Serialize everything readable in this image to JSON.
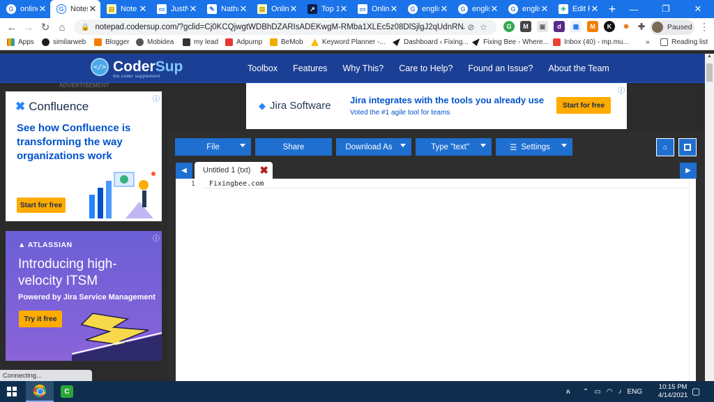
{
  "browser": {
    "tabs": [
      {
        "label": "online",
        "favicon": "google-icon"
      },
      {
        "label": "Notes",
        "favicon": "google-icon",
        "active": true
      },
      {
        "label": "Note",
        "favicon": "notepad-icon"
      },
      {
        "label": "JustN",
        "favicon": "doc-icon"
      },
      {
        "label": "Natha",
        "favicon": "doc-icon"
      },
      {
        "label": "Onlin",
        "favicon": "notepad-icon"
      },
      {
        "label": "Top 1",
        "favicon": "tv-icon"
      },
      {
        "label": "Onlin",
        "favicon": "doc-icon"
      },
      {
        "label": "englis",
        "favicon": "google-icon"
      },
      {
        "label": "englis",
        "favicon": "google-icon"
      },
      {
        "label": "englis",
        "favicon": "google-icon"
      },
      {
        "label": "Edit P",
        "favicon": "fixingbee-icon"
      }
    ],
    "new_tab": "+",
    "url": "notepad.codersup.com/?gclid=Cj0KCQjwgtWDBhDZARIsADEKwgM-RMba1XLEc5z08DlSjlgJ2qUdnRNAwP60LPM...",
    "profile_label": "Paused",
    "bookmarks": [
      {
        "label": "Apps"
      },
      {
        "label": "similarweb"
      },
      {
        "label": "Blogger"
      },
      {
        "label": "Mobidea"
      },
      {
        "label": "my lead"
      },
      {
        "label": "Adpump"
      },
      {
        "label": "BeMob"
      },
      {
        "label": "Keyword Planner -..."
      },
      {
        "label": "Dashboard ‹ Fixing..."
      },
      {
        "label": "Fixing Bee - Where..."
      },
      {
        "label": "Inbox (40) - mp.mu..."
      },
      {
        "label": "Reading list"
      }
    ],
    "status": "Connecting..."
  },
  "site": {
    "logo_name_a": "Coder",
    "logo_name_b": "Sup",
    "logo_tagline": "the coder supplement",
    "nav": [
      "Toolbox",
      "Features",
      "Why This?",
      "Care to Help?",
      "Found an Issue?",
      "About the Team"
    ],
    "ad_label": "ADVERTISEMENT"
  },
  "ads": {
    "confluence": {
      "brand": "Confluence",
      "headline": "See how Confluence is transforming the way organizations work",
      "cta": "Start for free"
    },
    "atlassian": {
      "brand": "ATLASSIAN",
      "headline": "Introducing high-velocity ITSM",
      "sub": "Powered by Jira Service Management",
      "cta": "Try it free"
    },
    "jira": {
      "brand": "Jira Software",
      "headline": "Jira integrates with the tools you already use",
      "sub": "Voted the #1 agile tool for teams",
      "cta": "Start for free"
    }
  },
  "editor": {
    "buttons": {
      "file": "File",
      "share": "Share",
      "download": "Download As",
      "type": "Type \"text\"",
      "settings": "Settings"
    },
    "file_tab": "Untitled 1 (txt)",
    "line_number": "1",
    "content": "Fixingbee.com"
  },
  "taskbar": {
    "lang": "ENG",
    "time": "10:15 PM",
    "date": "4/14/2021"
  },
  "colors": {
    "site_header": "#1b3f94",
    "button_blue": "#1e6fd0",
    "chrome_blue": "#1a73e8",
    "cta_yellow": "#ffab00"
  }
}
